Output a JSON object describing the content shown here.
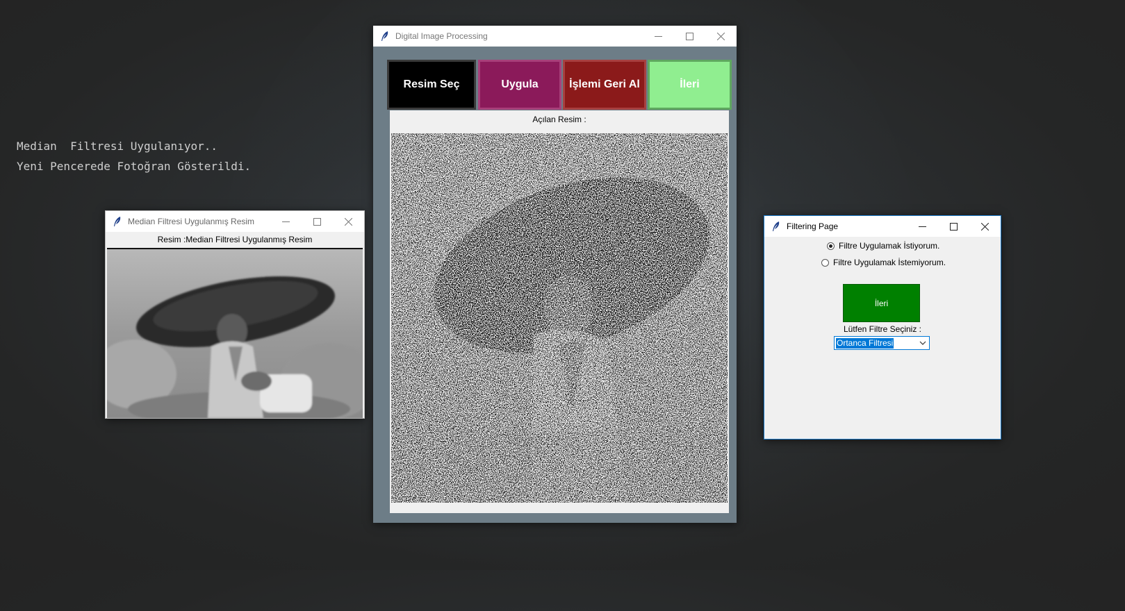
{
  "console": {
    "line1": "Median  Filtresi Uygulanıyor..",
    "line2": "Yeni Pencerede Fotoğran Gösterildi."
  },
  "main_window": {
    "title": "Digital Image Processing",
    "buttons": {
      "select": "Resim Seç",
      "apply": "Uygula",
      "undo": "İşlemi Geri Al",
      "next": "İleri"
    },
    "image_label": "Açılan Resim :"
  },
  "median_window": {
    "title": "Median Filtresi Uygulanmış Resim",
    "label": "Resim :Median Filtresi Uygulanmış Resim"
  },
  "filter_window": {
    "title": "Filtering Page",
    "radio_yes": "Filtre Uygulamak İstiyorum.",
    "radio_no": "Filtre Uygulamak İstemiyorum.",
    "radio_selected": "yes",
    "next_button": "İleri",
    "select_label": "Lütfen Filtre Seçiniz :",
    "selected_filter": "Ortanca Filtresi"
  },
  "colors": {
    "select_btn": "#000000",
    "apply_btn": "#8b1a5a",
    "undo_btn": "#8b1a1a",
    "next_btn": "#90ee90",
    "filter_next_btn": "#008000",
    "main_bg": "#6d7d87"
  }
}
